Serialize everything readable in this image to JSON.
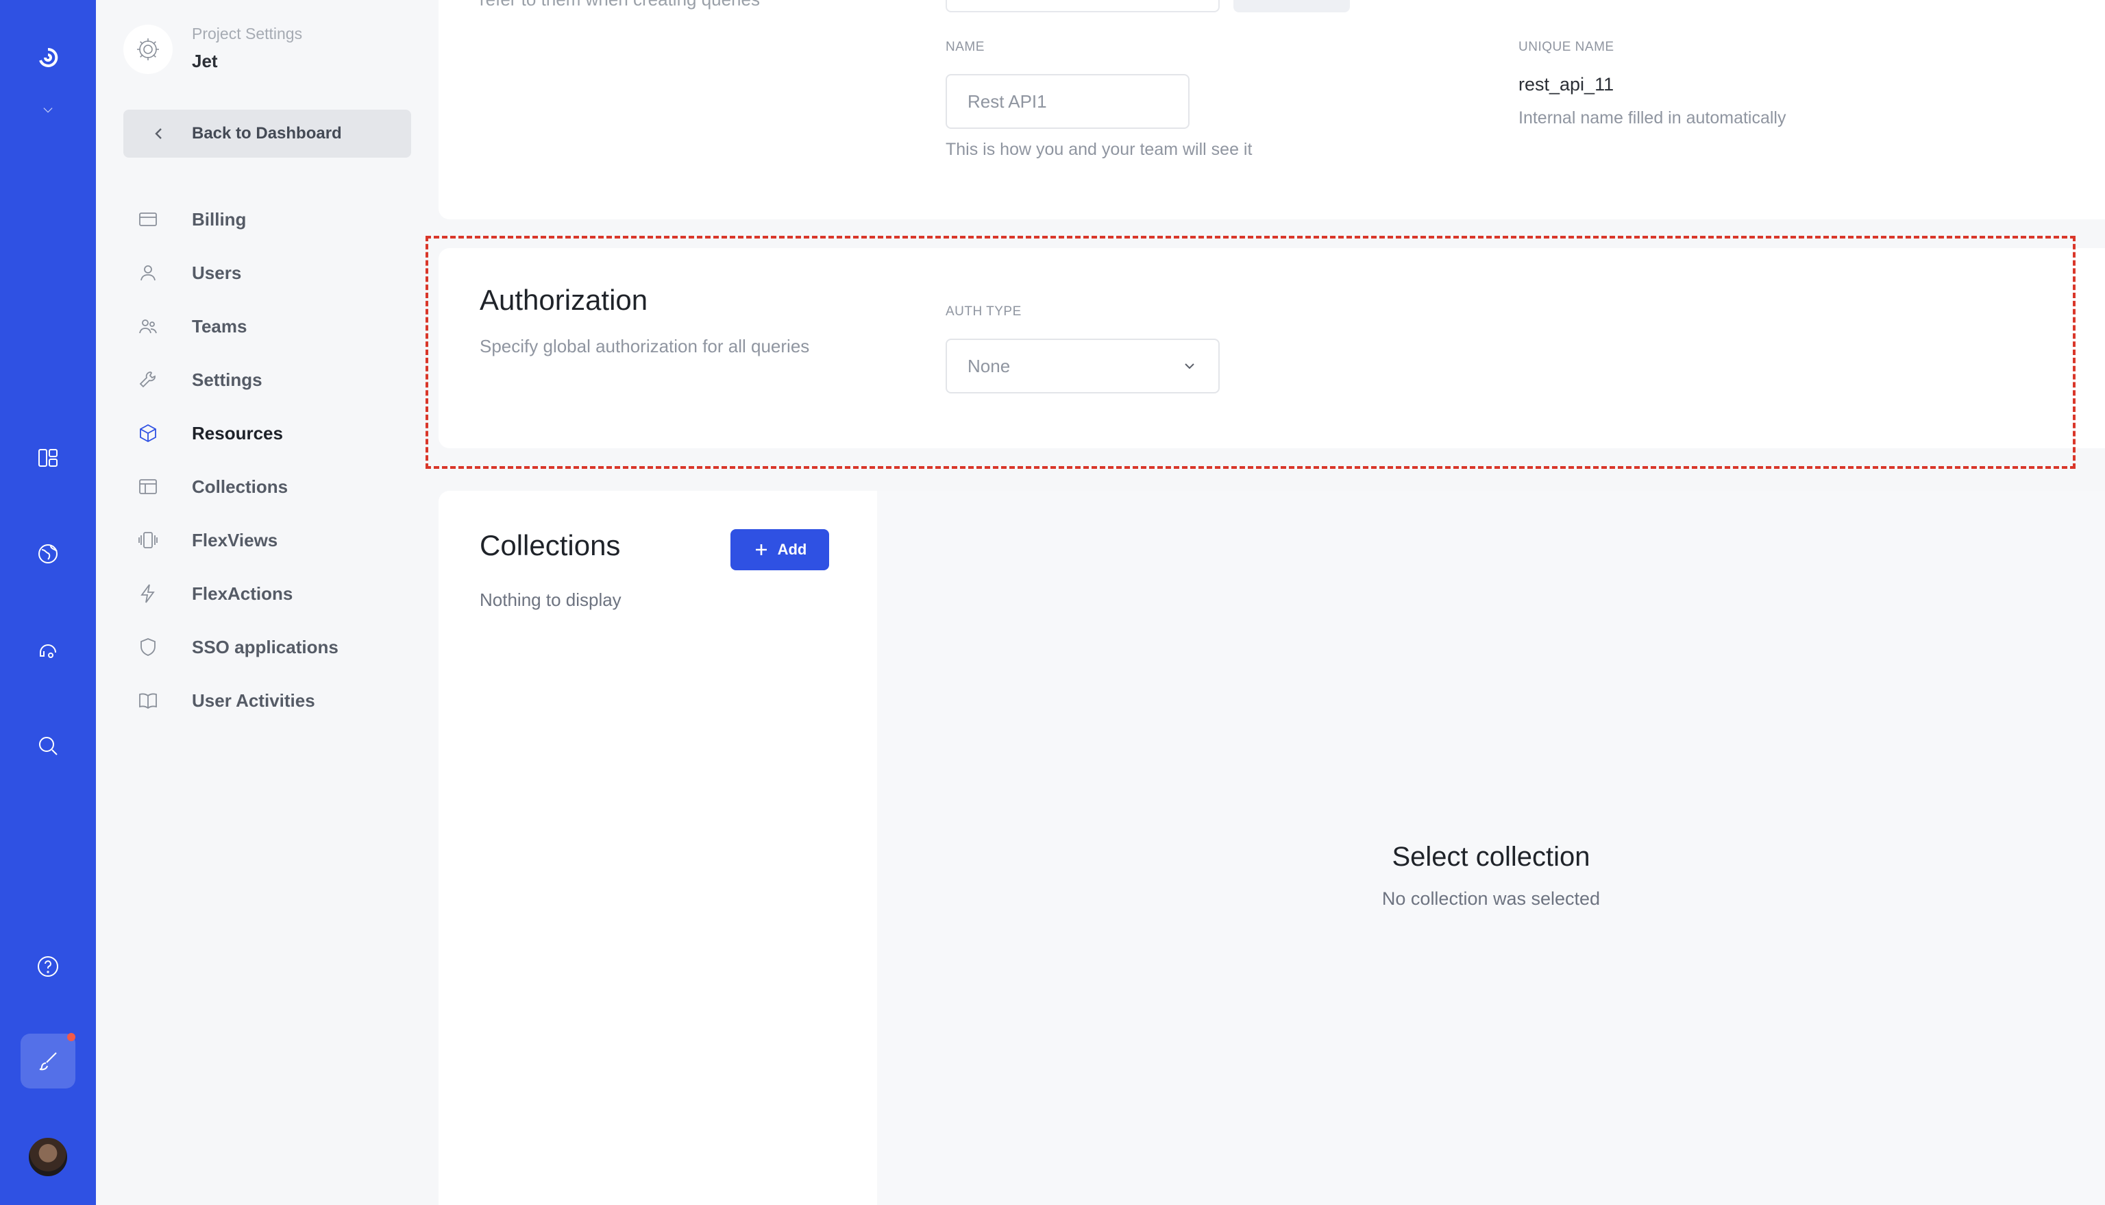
{
  "colors": {
    "rail": "#2f51e3",
    "accent": "#2f51e3",
    "highlight_border": "#d9372a",
    "notification_dot": "#f05a4a"
  },
  "rail": {
    "icons": [
      "logo-icon",
      "chevron-down-icon",
      "dashboard-icon",
      "globe-icon",
      "support-icon",
      "search-icon",
      "help-icon",
      "brush-icon",
      "user-avatar"
    ]
  },
  "sidebar": {
    "project_label": "Project Settings",
    "project_name": "Jet",
    "back_label": "Back to Dashboard",
    "items": [
      {
        "label": "Billing",
        "icon": "billing-icon"
      },
      {
        "label": "Users",
        "icon": "user-icon"
      },
      {
        "label": "Teams",
        "icon": "teams-icon"
      },
      {
        "label": "Settings",
        "icon": "wrench-icon"
      },
      {
        "label": "Resources",
        "icon": "cube-icon",
        "active": true
      },
      {
        "label": "Collections",
        "icon": "table-icon"
      },
      {
        "label": "FlexViews",
        "icon": "flexviews-icon"
      },
      {
        "label": "FlexActions",
        "icon": "lightning-icon"
      },
      {
        "label": "SSO applications",
        "icon": "shield-icon"
      },
      {
        "label": "User Activities",
        "icon": "book-icon"
      }
    ]
  },
  "general": {
    "cut_text": "refer to them when creating queries",
    "name_label": "NAME",
    "name_value": "Rest API1",
    "name_hint": "This is how you and your team will see it",
    "unique_label": "UNIQUE NAME",
    "unique_value": "rest_api_11",
    "unique_hint": "Internal name filled in automatically"
  },
  "authorization": {
    "title": "Authorization",
    "description": "Specify global authorization for all queries",
    "auth_type_label": "AUTH TYPE",
    "auth_type_value": "None"
  },
  "collections": {
    "title": "Collections",
    "add_label": "Add",
    "empty_text": "Nothing to display",
    "select_title": "Select collection",
    "select_subtitle": "No collection was selected"
  }
}
